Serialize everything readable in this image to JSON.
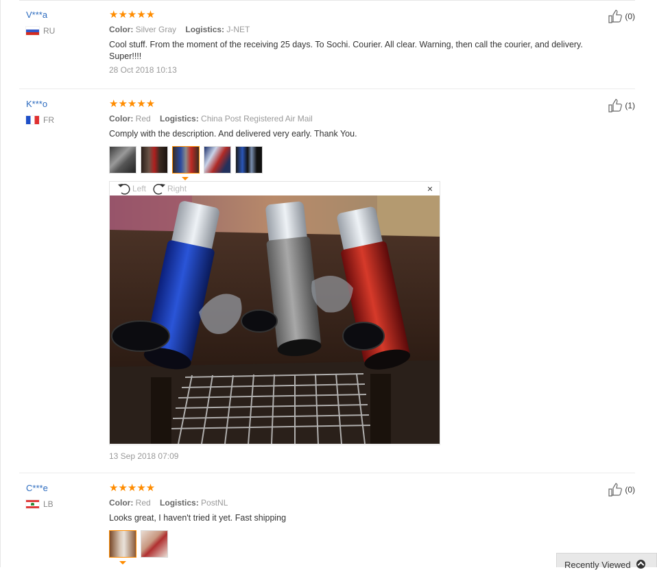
{
  "reviews": [
    {
      "user": "V***a",
      "country": "RU",
      "stars": "★★★★★",
      "color_label": "Color:",
      "color_value": "Silver Gray",
      "logistics_label": "Logistics:",
      "logistics_value": "J-NET",
      "text": "Cool stuff. From the moment of the receiving 25 days. To Sochi. Courier. All clear. Warning, then call the courier, and delivery. Super!!!!",
      "date": "28 Oct 2018 10:13",
      "helpful": "(0)"
    },
    {
      "user": "K***o",
      "country": "FR",
      "stars": "★★★★★",
      "color_label": "Color:",
      "color_value": "Red",
      "logistics_label": "Logistics:",
      "logistics_value": "China Post Registered Air Mail",
      "text": "Comply with the description. And delivered very early. Thank You.",
      "date": "13 Sep 2018 07:09",
      "helpful": "(1)",
      "viewer": {
        "rotate_left": "Left",
        "rotate_right": "Right",
        "close": "×"
      }
    },
    {
      "user": "C***e",
      "country": "LB",
      "stars": "★★★★★",
      "color_label": "Color:",
      "color_value": "Red",
      "logistics_label": "Logistics:",
      "logistics_value": "PostNL",
      "text": "Looks great, I haven't tried it yet. Fast shipping",
      "helpful": "(0)"
    }
  ],
  "recently_viewed": "Recently Viewed",
  "colors": {
    "accent": "#ff8c00",
    "link": "#2c6bbf"
  }
}
